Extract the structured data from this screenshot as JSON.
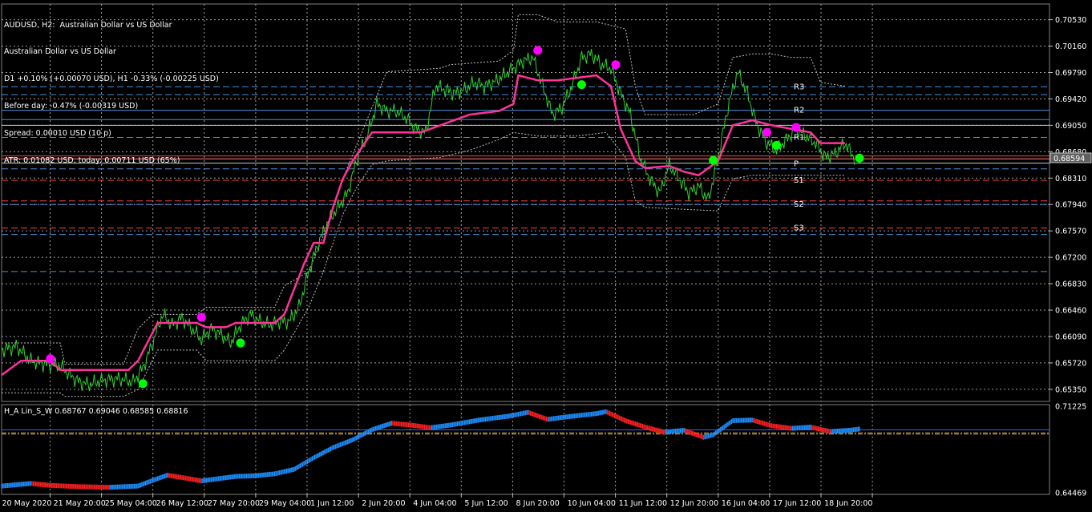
{
  "header": {
    "lines": [
      "AUDUSD, H2:  Australian Dollar vs US Dollar",
      "Australian Dollar vs US Dollar",
      "D1 +0.10% (+0.00070 USD), H1 -0.33% (-0.00225 USD)",
      "Before day: -0.47% (-0.00319 USD)",
      "Spread: 0.00010 USD (10 p)",
      "ATR: 0.01082 USD, today: 0.00711 USD (65%)"
    ]
  },
  "subwindow": {
    "label": "H_A Lin_S_W 0.68767 0.69046 0.68585 0.68816"
  },
  "colors": {
    "background": "#000000",
    "grid": "#c8c8c8",
    "price": "#32cd32",
    "centerline": "#ff3399",
    "envelope": "#c0c0c0",
    "marker_top": "#ff00ff",
    "marker_bottom": "#00ff00",
    "pivot_levels": "#ff4040",
    "fib_levels": "#4a90d9",
    "bar_up": "#1e90ff",
    "bar_down": "#ff2020",
    "sub_hline": "#3060ff",
    "sub_hline2": "#c8a040"
  },
  "chart_data": [
    {
      "type": "line",
      "title": "AUDUSD, H2",
      "xlabel": "",
      "ylabel": "",
      "ylim": [
        0.6518,
        0.7075
      ],
      "y_ticks": [
        "0.70530",
        "0.70160",
        "0.69790",
        "0.69420",
        "0.69050",
        "0.68680",
        "0.68310",
        "0.67940",
        "0.67570",
        "0.67200",
        "0.66830",
        "0.66460",
        "0.66090",
        "0.65720",
        "0.65350"
      ],
      "y_tick_values": [
        0.7053,
        0.7016,
        0.6979,
        0.6942,
        0.6905,
        0.6868,
        0.6831,
        0.6794,
        0.6757,
        0.672,
        0.6683,
        0.6646,
        0.6609,
        0.6572,
        0.6535
      ],
      "x_ticks": [
        "20 May 2020",
        "21 May 20:00",
        "25 May 04:00",
        "26 May 12:00",
        "27 May 20:00",
        "29 May 04:00",
        "1 Jun 12:00",
        "2 Jun 20:00",
        "4 Jun 04:00",
        "5 Jun 12:00",
        "8 Jun 20:00",
        "10 Jun 04:00",
        "11 Jun 12:00",
        "12 Jun 20:00",
        "16 Jun 04:00",
        "17 Jun 12:00",
        "18 Jun 20:00"
      ],
      "x_range": [
        0,
        176
      ],
      "current_price": "0.68594",
      "current_value": 0.68594,
      "price_keypoints": [
        [
          0,
          0.659
        ],
        [
          3,
          0.6595
        ],
        [
          6,
          0.6575
        ],
        [
          9,
          0.657
        ],
        [
          12,
          0.6568
        ],
        [
          14,
          0.6555
        ],
        [
          16,
          0.6545
        ],
        [
          18,
          0.6542
        ],
        [
          21,
          0.6548
        ],
        [
          24,
          0.655
        ],
        [
          27,
          0.6545
        ],
        [
          29,
          0.6565
        ],
        [
          31,
          0.66
        ],
        [
          33,
          0.664
        ],
        [
          35,
          0.6625
        ],
        [
          37,
          0.6635
        ],
        [
          39,
          0.662
        ],
        [
          41,
          0.6605
        ],
        [
          43,
          0.662
        ],
        [
          45,
          0.6612
        ],
        [
          47,
          0.66
        ],
        [
          49,
          0.6625
        ],
        [
          51,
          0.664
        ],
        [
          53,
          0.663
        ],
        [
          55,
          0.6625
        ],
        [
          57,
          0.663
        ],
        [
          59,
          0.663
        ],
        [
          61,
          0.665
        ],
        [
          63,
          0.67
        ],
        [
          65,
          0.674
        ],
        [
          67,
          0.677
        ],
        [
          69,
          0.679
        ],
        [
          71,
          0.681
        ],
        [
          73,
          0.686
        ],
        [
          75,
          0.689
        ],
        [
          77,
          0.6935
        ],
        [
          79,
          0.6925
        ],
        [
          81,
          0.6925
        ],
        [
          83,
          0.6915
        ],
        [
          85,
          0.69
        ],
        [
          87,
          0.6895
        ],
        [
          89,
          0.696
        ],
        [
          91,
          0.6955
        ],
        [
          93,
          0.695
        ],
        [
          95,
          0.6955
        ],
        [
          97,
          0.6965
        ],
        [
          99,
          0.696
        ],
        [
          101,
          0.6965
        ],
        [
          103,
          0.6975
        ],
        [
          105,
          0.6985
        ],
        [
          107,
          0.6995
        ],
        [
          109,
          0.7
        ],
        [
          111,
          0.696
        ],
        [
          113,
          0.692
        ],
        [
          115,
          0.693
        ],
        [
          117,
          0.696
        ],
        [
          119,
          0.7
        ],
        [
          121,
          0.7005
        ],
        [
          123,
          0.699
        ],
        [
          125,
          0.6985
        ],
        [
          127,
          0.695
        ],
        [
          129,
          0.692
        ],
        [
          131,
          0.686
        ],
        [
          133,
          0.683
        ],
        [
          135,
          0.681
        ],
        [
          137,
          0.685
        ],
        [
          139,
          0.683
        ],
        [
          141,
          0.681
        ],
        [
          143,
          0.682
        ],
        [
          145,
          0.68
        ],
        [
          147,
          0.686
        ],
        [
          149,
          0.693
        ],
        [
          151,
          0.698
        ],
        [
          153,
          0.695
        ],
        [
          155,
          0.6905
        ],
        [
          157,
          0.688
        ],
        [
          159,
          0.687
        ],
        [
          161,
          0.6885
        ],
        [
          163,
          0.69
        ],
        [
          165,
          0.689
        ],
        [
          167,
          0.688
        ],
        [
          169,
          0.686
        ],
        [
          171,
          0.6865
        ],
        [
          173,
          0.688
        ],
        [
          175,
          0.6859
        ]
      ],
      "centerline_keypoints": [
        [
          0,
          0.6555
        ],
        [
          4,
          0.6575
        ],
        [
          10,
          0.6575
        ],
        [
          12,
          0.6562
        ],
        [
          26,
          0.6562
        ],
        [
          28,
          0.6575
        ],
        [
          32,
          0.6628
        ],
        [
          40,
          0.6628
        ],
        [
          42,
          0.6622
        ],
        [
          46,
          0.6622
        ],
        [
          48,
          0.6628
        ],
        [
          56,
          0.6628
        ],
        [
          58,
          0.664
        ],
        [
          62,
          0.671
        ],
        [
          64,
          0.674
        ],
        [
          66,
          0.674
        ],
        [
          68,
          0.679
        ],
        [
          70,
          0.683
        ],
        [
          72,
          0.6855
        ],
        [
          76,
          0.6895
        ],
        [
          86,
          0.6895
        ],
        [
          90,
          0.6905
        ],
        [
          96,
          0.692
        ],
        [
          102,
          0.6925
        ],
        [
          105,
          0.6935
        ],
        [
          106,
          0.6975
        ],
        [
          110,
          0.6968
        ],
        [
          114,
          0.6968
        ],
        [
          122,
          0.6975
        ],
        [
          125,
          0.696
        ],
        [
          127,
          0.69
        ],
        [
          130,
          0.6855
        ],
        [
          132,
          0.6845
        ],
        [
          137,
          0.6848
        ],
        [
          140,
          0.684
        ],
        [
          143,
          0.6835
        ],
        [
          147,
          0.6855
        ],
        [
          150,
          0.6905
        ],
        [
          154,
          0.6912
        ],
        [
          158,
          0.6905
        ],
        [
          162,
          0.69
        ],
        [
          166,
          0.6895
        ],
        [
          168,
          0.688
        ],
        [
          173,
          0.688
        ]
      ],
      "envelope_upper_keypoints": [
        [
          0,
          0.66
        ],
        [
          12,
          0.66
        ],
        [
          13,
          0.657
        ],
        [
          25,
          0.657
        ],
        [
          28,
          0.662
        ],
        [
          31,
          0.664
        ],
        [
          40,
          0.664
        ],
        [
          42,
          0.665
        ],
        [
          56,
          0.665
        ],
        [
          58,
          0.668
        ],
        [
          63,
          0.67
        ],
        [
          66,
          0.675
        ],
        [
          70,
          0.683
        ],
        [
          73,
          0.688
        ],
        [
          76,
          0.693
        ],
        [
          79,
          0.698
        ],
        [
          90,
          0.6985
        ],
        [
          92,
          0.699
        ],
        [
          102,
          0.6995
        ],
        [
          105,
          0.701
        ],
        [
          106,
          0.706
        ],
        [
          110,
          0.706
        ],
        [
          114,
          0.705
        ],
        [
          122,
          0.705
        ],
        [
          128,
          0.704
        ],
        [
          130,
          0.696
        ],
        [
          132,
          0.692
        ],
        [
          142,
          0.692
        ],
        [
          147,
          0.6935
        ],
        [
          150,
          0.7
        ],
        [
          154,
          0.7005
        ],
        [
          158,
          0.7005
        ],
        [
          162,
          0.7
        ],
        [
          166,
          0.7
        ],
        [
          168,
          0.6965
        ],
        [
          173,
          0.696
        ]
      ],
      "envelope_lower_keypoints": [
        [
          0,
          0.653
        ],
        [
          12,
          0.653
        ],
        [
          13,
          0.6525
        ],
        [
          25,
          0.6525
        ],
        [
          28,
          0.6535
        ],
        [
          32,
          0.659
        ],
        [
          40,
          0.659
        ],
        [
          42,
          0.6575
        ],
        [
          56,
          0.6575
        ],
        [
          58,
          0.659
        ],
        [
          63,
          0.665
        ],
        [
          66,
          0.67
        ],
        [
          70,
          0.678
        ],
        [
          73,
          0.682
        ],
        [
          76,
          0.685
        ],
        [
          79,
          0.6855
        ],
        [
          90,
          0.686
        ],
        [
          96,
          0.687
        ],
        [
          102,
          0.6885
        ],
        [
          105,
          0.6895
        ],
        [
          110,
          0.689
        ],
        [
          118,
          0.689
        ],
        [
          124,
          0.6895
        ],
        [
          128,
          0.686
        ],
        [
          130,
          0.68
        ],
        [
          132,
          0.679
        ],
        [
          147,
          0.6785
        ],
        [
          150,
          0.683
        ],
        [
          154,
          0.6835
        ],
        [
          166,
          0.6835
        ],
        [
          168,
          0.6835
        ],
        [
          173,
          0.6835
        ]
      ],
      "markers_top": [
        [
          10,
          0.6578
        ],
        [
          41,
          0.6636
        ],
        [
          110,
          0.701
        ],
        [
          126,
          0.699
        ],
        [
          157,
          0.6895
        ],
        [
          163,
          0.6902
        ]
      ],
      "markers_bottom": [
        [
          29,
          0.6543
        ],
        [
          49,
          0.66
        ],
        [
          119,
          0.6962
        ],
        [
          146,
          0.6856
        ],
        [
          159,
          0.6877
        ],
        [
          176,
          0.6859
        ]
      ],
      "levels": [
        {
          "label": "R3",
          "value": 0.6959,
          "color": "#4a90d9",
          "style": "dash"
        },
        {
          "label": "",
          "value": 0.6948,
          "color": "#4a90d9",
          "style": "dash"
        },
        {
          "label": "R2",
          "value": 0.6926,
          "color": "#4a90d9",
          "style": "solid"
        },
        {
          "label": "",
          "value": 0.6913,
          "color": "#4a90d9",
          "style": "solid"
        },
        {
          "label": "",
          "value": 0.6905,
          "color": "#c8c8c8",
          "style": "solid"
        },
        {
          "label": "R1",
          "value": 0.6888,
          "color": "#4a90d9",
          "style": "dash"
        },
        {
          "label": "",
          "value": 0.6862,
          "color": "#ff4040",
          "style": "solid"
        },
        {
          "label": "",
          "value": 0.6858,
          "color": "#ff8080",
          "style": "solid"
        },
        {
          "label": "P",
          "value": 0.6852,
          "color": "#c8c8c8",
          "style": "solid"
        },
        {
          "label": "",
          "value": 0.6844,
          "color": "#4a90d9",
          "style": "dash"
        },
        {
          "label": "S1",
          "value": 0.6828,
          "color": "#ff4040",
          "style": "dash"
        },
        {
          "label": "",
          "value": 0.6799,
          "color": "#ff4040",
          "style": "dash"
        },
        {
          "label": "S2",
          "value": 0.6794,
          "color": "#4a90d9",
          "style": "dash"
        },
        {
          "label": "S3",
          "value": 0.6761,
          "color": "#ff4040",
          "style": "dash"
        },
        {
          "label": "",
          "value": 0.6752,
          "color": "#4a90d9",
          "style": "dash"
        },
        {
          "label": "",
          "value": 0.67,
          "color": "#4a90d9",
          "style": "dash"
        }
      ]
    },
    {
      "type": "bar",
      "title": "H_A Lin_S_W",
      "ylim": [
        0.6435,
        0.7135
      ],
      "y_ticks": [
        "0.71225",
        "0.64469"
      ],
      "y_tick_values": [
        0.71225,
        0.64469
      ],
      "hline_values": [
        0.6938,
        0.6915,
        0.6905
      ],
      "trend_keypoints": [
        [
          0,
          0.65
        ],
        [
          6,
          0.652
        ],
        [
          10,
          0.6505
        ],
        [
          16,
          0.6495
        ],
        [
          22,
          0.649
        ],
        [
          28,
          0.65
        ],
        [
          30,
          0.653
        ],
        [
          34,
          0.6585
        ],
        [
          38,
          0.656
        ],
        [
          41,
          0.654
        ],
        [
          44,
          0.6555
        ],
        [
          48,
          0.6575
        ],
        [
          52,
          0.658
        ],
        [
          56,
          0.6595
        ],
        [
          60,
          0.663
        ],
        [
          64,
          0.672
        ],
        [
          68,
          0.68
        ],
        [
          72,
          0.686
        ],
        [
          76,
          0.694
        ],
        [
          80,
          0.699
        ],
        [
          84,
          0.6975
        ],
        [
          88,
          0.6955
        ],
        [
          92,
          0.6975
        ],
        [
          98,
          0.7015
        ],
        [
          104,
          0.7045
        ],
        [
          108,
          0.7075
        ],
        [
          112,
          0.702
        ],
        [
          116,
          0.704
        ],
        [
          122,
          0.7065
        ],
        [
          124,
          0.708
        ],
        [
          128,
          0.701
        ],
        [
          132,
          0.696
        ],
        [
          136,
          0.692
        ],
        [
          140,
          0.6935
        ],
        [
          144,
          0.688
        ],
        [
          146,
          0.69
        ],
        [
          150,
          0.701
        ],
        [
          154,
          0.7015
        ],
        [
          158,
          0.697
        ],
        [
          162,
          0.695
        ],
        [
          166,
          0.696
        ],
        [
          170,
          0.6925
        ],
        [
          174,
          0.6935
        ],
        [
          176,
          0.6945
        ]
      ]
    }
  ]
}
